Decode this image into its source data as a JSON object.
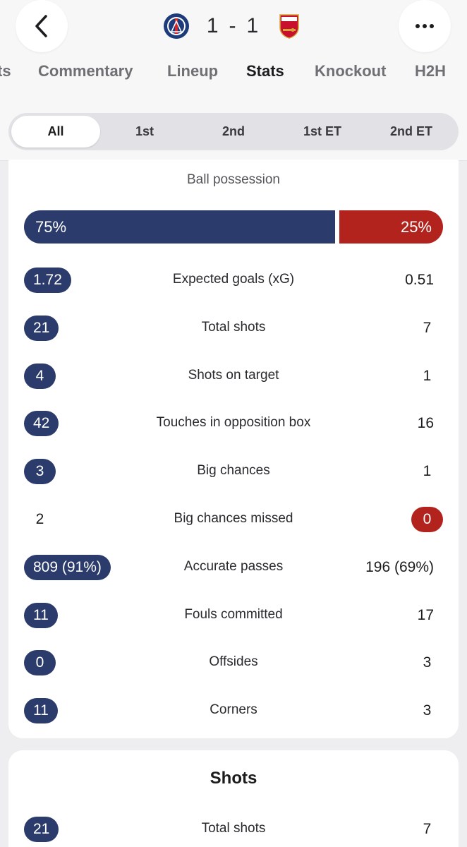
{
  "header": {
    "score_home": "1",
    "score_sep": "-",
    "score_away": "1",
    "home_crest": "psg-crest-icon",
    "away_crest": "arsenal-crest-icon"
  },
  "tabs": [
    "ts",
    "Commentary",
    "Lineup",
    "Stats",
    "Knockout",
    "H2H"
  ],
  "active_tab": "Stats",
  "periods": [
    "All",
    "1st",
    "2nd",
    "1st ET",
    "2nd ET"
  ],
  "active_period": "All",
  "colors": {
    "home": "#2b3b6b",
    "away": "#b3231d"
  },
  "possession": {
    "title": "Ball possession",
    "home": "75%",
    "away": "25%",
    "home_fraction": 0.75
  },
  "stats": [
    {
      "label": "Expected goals (xG)",
      "home": "1.72",
      "away": "0.51",
      "highlight": "home"
    },
    {
      "label": "Total shots",
      "home": "21",
      "away": "7",
      "highlight": "home"
    },
    {
      "label": "Shots on target",
      "home": "4",
      "away": "1",
      "highlight": "home"
    },
    {
      "label": "Touches in opposition box",
      "home": "42",
      "away": "16",
      "highlight": "home"
    },
    {
      "label": "Big chances",
      "home": "3",
      "away": "1",
      "highlight": "home"
    },
    {
      "label": "Big chances missed",
      "home": "2",
      "away": "0",
      "highlight": "away"
    },
    {
      "label": "Accurate passes",
      "home": "809 (91%)",
      "away": "196 (69%)",
      "highlight": "home"
    },
    {
      "label": "Fouls committed",
      "home": "11",
      "away": "17",
      "highlight": "home"
    },
    {
      "label": "Offsides",
      "home": "0",
      "away": "3",
      "highlight": "home"
    },
    {
      "label": "Corners",
      "home": "11",
      "away": "3",
      "highlight": "home"
    }
  ],
  "shots_section": {
    "title": "Shots",
    "rows": [
      {
        "label": "Total shots",
        "home": "21",
        "away": "7",
        "highlight": "home"
      }
    ]
  }
}
